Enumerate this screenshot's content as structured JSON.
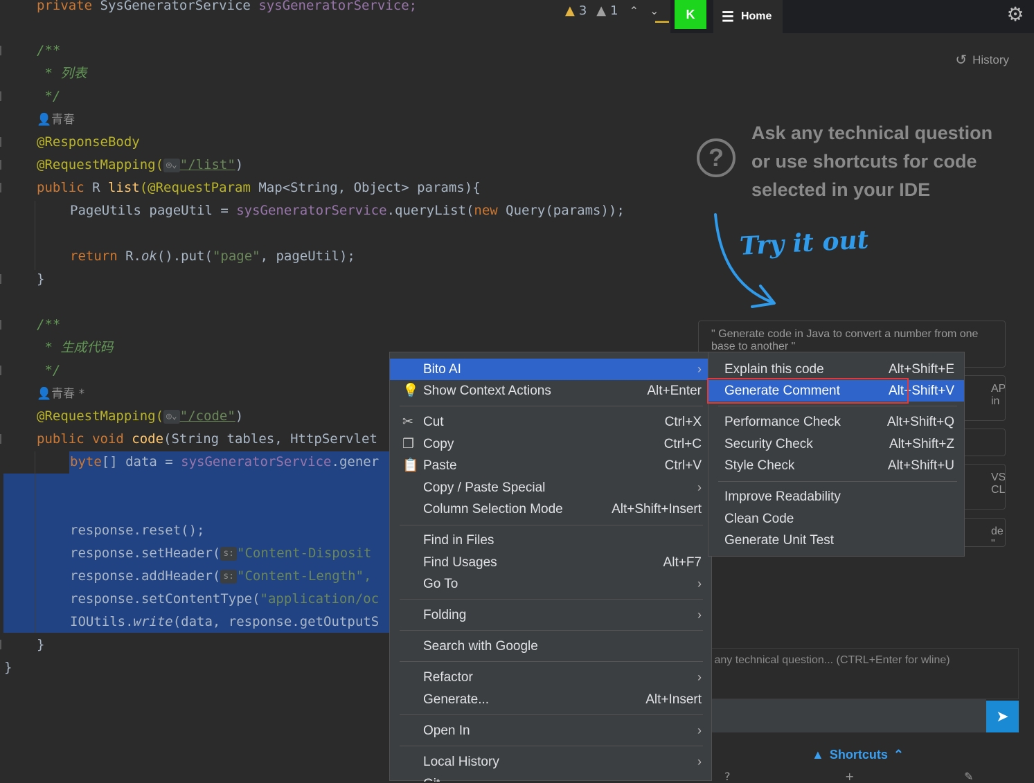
{
  "editor": {
    "lines": {
      "l0_kw": "private",
      "l0_type": "SysGeneratorService",
      "l0_field": "sysGeneratorService;",
      "c1_open": "/**",
      "c1_text": " * 列表",
      "c1_close": " */",
      "author1": "青春",
      "ann_response_body": "@ResponseBody",
      "ann_request_mapping": "@RequestMapping(",
      "path_list": "\"/list\"",
      "close_paren": ")",
      "list_sig_kw": "public",
      "list_sig_rest": " R ",
      "list_sig_fn": "list",
      "list_sig_ann": "(@RequestParam",
      "list_sig_tail": " Map<String, Object> params){",
      "pageutil_decl": "PageUtils pageUtil = ",
      "pageutil_field": "sysGeneratorService",
      "pageutil_call": ".queryList(",
      "pageutil_new": "new",
      "pageutil_end": " Query(params));",
      "return_kw": "return",
      "return_r": " R.",
      "return_ok": "ok",
      "return_put": "().put(",
      "return_page": "\"page\"",
      "return_end": ", pageUtil);",
      "brace_close": "}",
      "c2_open": "/**",
      "c2_text": " * 生成代码",
      "c2_close": " */",
      "author2": "青春 *",
      "path_code": "\"/code\"",
      "code_sig_kw": "public void",
      "code_sig_fn": " code",
      "code_sig_tail": "(String tables, HttpServlet",
      "byte_kw": "byte",
      "byte_rest": "[] data = ",
      "byte_field": "sysGeneratorService",
      "byte_call": ".gener",
      "reset": "response.reset();",
      "setheader_call": "response.setHeader(",
      "setheader_hint": "s:",
      "setheader_str": "\"Content-Disposit",
      "addheader_call": "response.addHeader(",
      "addheader_hint": "s:",
      "addheader_str": "\"Content-Length\",",
      "setcontent_call": "response.setContentType(",
      "setcontent_str": "\"application/oc",
      "ioutils": "IOUtils.",
      "ioutils_write": "write",
      "ioutils_rest": "(data, response.getOutputS",
      "brace_close_inner": "}",
      "brace_close_outer": "}"
    },
    "inspections": {
      "warnings": "3",
      "weak_warnings": "1"
    }
  },
  "panel": {
    "avatar_letter": "K",
    "home_tab": "Home",
    "history": "History",
    "ask_title": "Ask any technical question or use shortcuts for code selected in your IDE",
    "try_it": "Try it out",
    "prompt_cards": [
      "\" Generate code in Java to convert a number from one base to another \"",
      "API in",
      "",
      "VS CLI",
      "de \""
    ],
    "input_placeholder": "k any technical question... (CTRL+Enter for wline)",
    "shortcuts": "Shortcuts"
  },
  "context_menu": {
    "items": [
      {
        "label": "Bito AI",
        "shortcut": "",
        "submenu": true
      },
      {
        "label": "Show Context Actions",
        "shortcut": "Alt+Enter"
      },
      {
        "label": "Cut",
        "shortcut": "Ctrl+X"
      },
      {
        "label": "Copy",
        "shortcut": "Ctrl+C"
      },
      {
        "label": "Paste",
        "shortcut": "Ctrl+V"
      },
      {
        "label": "Copy / Paste Special",
        "shortcut": ""
      },
      {
        "label": "Column Selection Mode",
        "shortcut": "Alt+Shift+Insert"
      },
      {
        "label": "Find in Files",
        "shortcut": ""
      },
      {
        "label": "Find Usages",
        "shortcut": "Alt+F7"
      },
      {
        "label": "Go To",
        "shortcut": ""
      },
      {
        "label": "Folding",
        "shortcut": ""
      },
      {
        "label": "Search with Google",
        "shortcut": ""
      },
      {
        "label": "Refactor",
        "shortcut": ""
      },
      {
        "label": "Generate...",
        "shortcut": "Alt+Insert"
      },
      {
        "label": "Open In",
        "shortcut": ""
      },
      {
        "label": "Local History",
        "shortcut": ""
      },
      {
        "label": "Git",
        "shortcut": ""
      }
    ]
  },
  "bito_submenu": {
    "items": [
      {
        "label": "Explain this code",
        "shortcut": "Alt+Shift+E"
      },
      {
        "label": "Generate Comment",
        "shortcut": "Alt+Shift+V"
      },
      {
        "label": "Performance Check",
        "shortcut": "Alt+Shift+Q"
      },
      {
        "label": "Security Check",
        "shortcut": "Alt+Shift+Z"
      },
      {
        "label": "Style Check",
        "shortcut": "Alt+Shift+U"
      },
      {
        "label": "Improve Readability",
        "shortcut": ""
      },
      {
        "label": "Clean Code",
        "shortcut": ""
      },
      {
        "label": "Generate Unit Test",
        "shortcut": ""
      }
    ]
  },
  "colors": {
    "selection": "#214283",
    "menu_highlight": "#2f65ca",
    "accent": "#1a8ad4",
    "highlight_box": "#e23a3a"
  }
}
